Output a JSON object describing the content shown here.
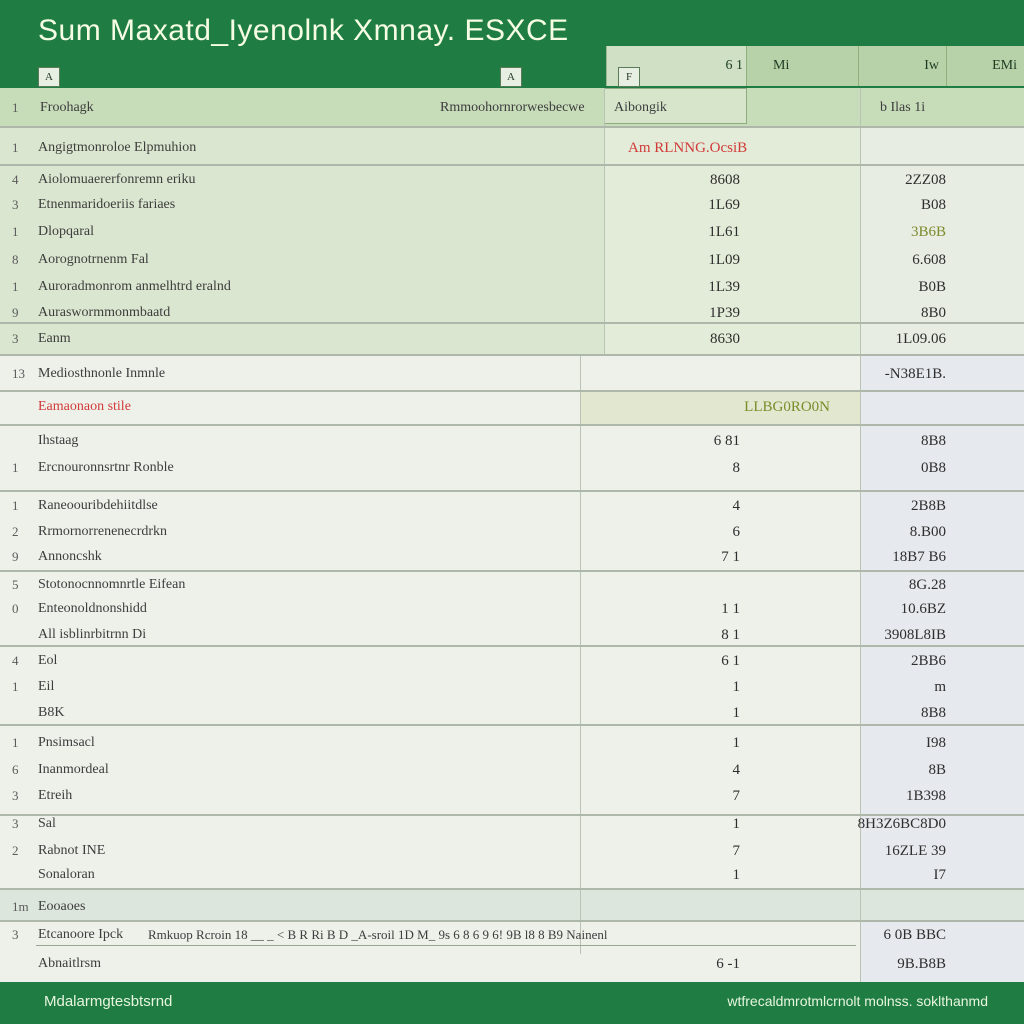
{
  "app": {
    "title": "Sum Maxatd_Iyenolnk Xmnay. ESXCE"
  },
  "toolbar": {
    "ctl1": "A",
    "ctl2": "A",
    "ctl3": "F",
    "ctl4": "6 1"
  },
  "column_headers": {
    "c1": "Mi",
    "c2": "Iw",
    "c3": "EMi"
  },
  "header_row": {
    "num": "1",
    "label": "Froohagk",
    "mid": "Rmmoohornrorwesbecwe",
    "box": "Aibongik",
    "right": "b Ilas 1i"
  },
  "rows": [
    {
      "n": "1",
      "label": "Angigtmonroloe Elpmuhion",
      "v1": "Am RLNNG.OcsiB",
      "v2": "",
      "style": "red"
    },
    {
      "n": "4",
      "label": "Aiolomuaererfonremn eriku",
      "v1": "8608",
      "v2": "2ZZ08"
    },
    {
      "n": "3",
      "label": "Etnenmaridoeriis fariaes",
      "v1": "1L69",
      "v2": "B08"
    },
    {
      "n": "1",
      "label": "Dlopqaral",
      "v1": "1L61",
      "v2": "3B6B",
      "v2style": "olive"
    },
    {
      "n": "8",
      "label": "Aorognotrnenm  Fal",
      "v1": "1L09",
      "v2": "6.608"
    },
    {
      "n": "1",
      "label": "Auroradmonrom anmelhtrd eralnd",
      "v1": "1L39",
      "v2": "B0B"
    },
    {
      "n": "9",
      "label": "Auraswormmonmbaatd",
      "v1": "1P39",
      "v2": "8B0"
    },
    {
      "n": "3",
      "label": "Eanm",
      "v1": "8630",
      "v2": "1L09.06"
    },
    {
      "n": "13",
      "label": "Mediosthnonle Inmnle",
      "v1": "",
      "v2": "-N38E1B."
    },
    {
      "n": "",
      "label": "Eamaonaon stile",
      "v1": "LLBG0RO0N",
      "v2": "",
      "style": "redlabel"
    },
    {
      "n": "",
      "label": "Ihstaag",
      "v1": "6 81",
      "v2": "8B8"
    },
    {
      "n": "1",
      "label": "Ercnouronnsrtnr  Ronble",
      "v1": "8",
      "v2": "0B8"
    },
    {
      "n": "1",
      "label": "Raneoouribdehiitdlse",
      "v1": "4",
      "v2": "2B8B"
    },
    {
      "n": "2",
      "label": "Rrmornorrenenecrdrkn",
      "v1": "6",
      "v2": "8.B00"
    },
    {
      "n": "9",
      "label": "Annoncshk",
      "v1": "7  1",
      "v2": "18B7 B6"
    },
    {
      "n": "5",
      "label": "Stotonocnnomnrtle  Eifean",
      "v1": "",
      "v2": "8G.28"
    },
    {
      "n": "0",
      "label": "Enteonoldnonshidd",
      "v1": "1 1",
      "v2": "10.6BZ"
    },
    {
      "n": "",
      "label": "All isblinrbitrnn  Di",
      "v1": "8 1",
      "v2": "3908L8IB"
    },
    {
      "n": "4",
      "label": "Eol",
      "v1": "6 1",
      "v2": "2BB6"
    },
    {
      "n": "1",
      "label": "Eil",
      "v1": "1",
      "v2": "m"
    },
    {
      "n": "",
      "label": "B8K",
      "v1": "1",
      "v2": "8B8"
    },
    {
      "n": "1",
      "label": "Pnsimsacl",
      "v1": "1",
      "v2": "I98"
    },
    {
      "n": "6",
      "label": "Inanmordeal",
      "v1": "4",
      "v2": "8B"
    },
    {
      "n": "3",
      "label": "Etreih",
      "v1": "7",
      "v2": "1B398"
    },
    {
      "n": "3",
      "label": "Sal",
      "v1": "1",
      "v2": "8H3Z6BC8D0"
    },
    {
      "n": "2",
      "label": "Rabnot INE",
      "v1": "7",
      "v2": "16ZLE 39"
    },
    {
      "n": "",
      "label": "Sonaloran",
      "v1": "1",
      "v2": "I7"
    },
    {
      "n": "1m",
      "label": "Eooaoes",
      "v1": "",
      "v2": ""
    },
    {
      "n": "3",
      "label": "Etcanoore  Ipck",
      "v1": "Rmkuop Rcroin 18 __ _ < B R Ri B  D _A-sroil 1D M_ 9s 6 8 6 9  6! 9B l8 8 B9 Nainenl",
      "v2": "6 0B BBC",
      "style": "long"
    },
    {
      "n": "",
      "label": "Abnaitlrsm",
      "v1": "6 -1",
      "v2": "9B.B8B"
    }
  ],
  "status": {
    "left": "Mdalarmgtesbtsrnd",
    "right": "wtfrecaldmrotmlcrnolt molnss. soklthanmd"
  }
}
